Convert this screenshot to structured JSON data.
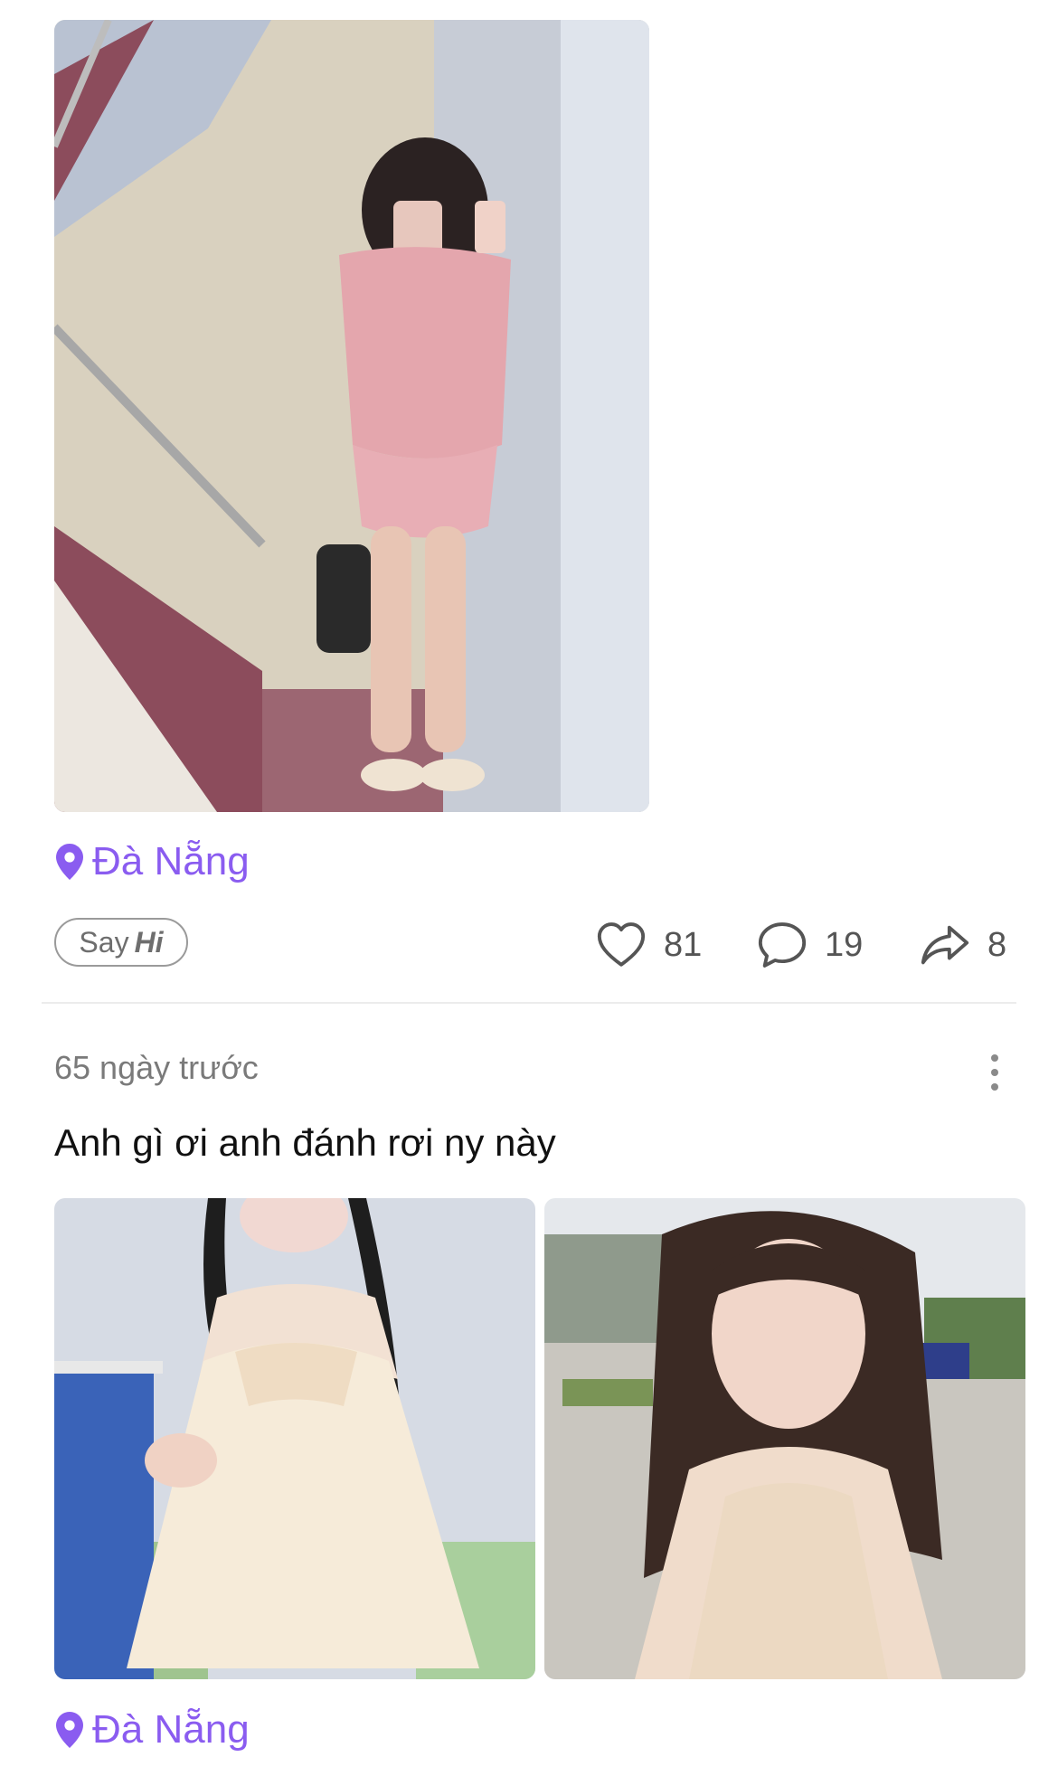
{
  "colors": {
    "accent": "#8a5cf0",
    "muted_text": "#7a7a7a",
    "divider": "#ececec"
  },
  "posts": [
    {
      "image_count": 1,
      "location": "Đà Nẵng",
      "say_hi": {
        "say": "Say",
        "hi": "Hi"
      },
      "stats": {
        "likes": "81",
        "comments": "19",
        "shares": "8"
      }
    },
    {
      "time": "65 ngày trước",
      "caption": "Anh gì ơi anh đánh rơi ny này",
      "image_count": 2,
      "location": "Đà Nẵng"
    }
  ],
  "icons": {
    "location": "location-pin-icon",
    "like": "heart-icon",
    "comment": "comment-bubble-icon",
    "share": "share-arrow-icon",
    "more": "more-vertical-icon"
  }
}
